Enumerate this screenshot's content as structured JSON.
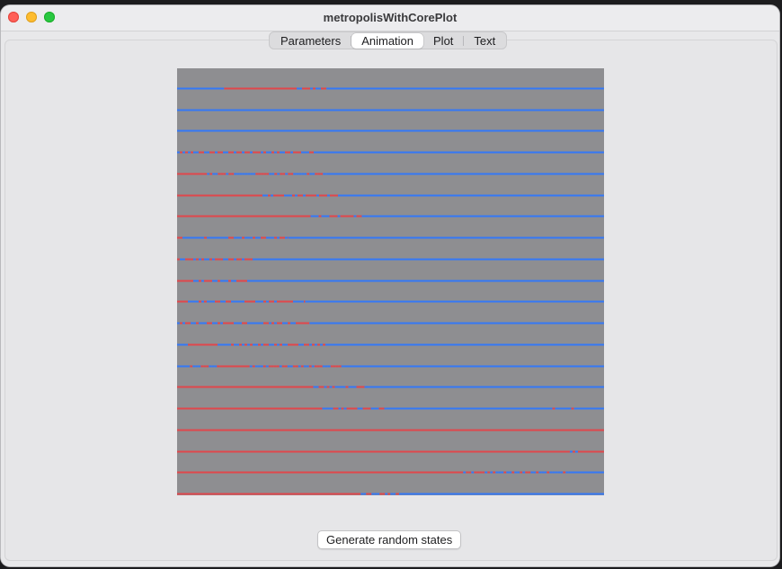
{
  "window": {
    "title": "metropolisWithCorePlot"
  },
  "tabs": [
    {
      "label": "Parameters",
      "selected": false
    },
    {
      "label": "Animation",
      "selected": true
    },
    {
      "label": "Plot",
      "selected": false
    },
    {
      "label": "Text",
      "selected": false
    }
  ],
  "animation": {
    "background_color": "#8e8e91",
    "spin_up_color": "#e0474c",
    "spin_down_color": "#3478f6",
    "rows": [
      {
        "segments": [
          [
            0.0,
            0.11,
            "down"
          ],
          [
            0.11,
            0.28,
            "up"
          ],
          [
            0.28,
            0.35,
            "mixed"
          ],
          [
            0.35,
            1.0,
            "down"
          ]
        ]
      },
      {
        "segments": [
          [
            0.0,
            1.0,
            "down"
          ]
        ]
      },
      {
        "segments": [
          [
            0.0,
            1.0,
            "down"
          ]
        ]
      },
      {
        "segments": [
          [
            0.0,
            0.32,
            "mixed"
          ],
          [
            0.32,
            1.0,
            "down"
          ]
        ]
      },
      {
        "segments": [
          [
            0.0,
            0.07,
            "up"
          ],
          [
            0.07,
            0.35,
            "mixed"
          ],
          [
            0.35,
            1.0,
            "down"
          ]
        ]
      },
      {
        "segments": [
          [
            0.0,
            0.2,
            "up"
          ],
          [
            0.2,
            0.38,
            "mixed"
          ],
          [
            0.38,
            1.0,
            "down"
          ]
        ]
      },
      {
        "segments": [
          [
            0.0,
            0.3,
            "up"
          ],
          [
            0.3,
            0.45,
            "mixed"
          ],
          [
            0.45,
            1.0,
            "down"
          ]
        ]
      },
      {
        "segments": [
          [
            0.0,
            0.26,
            "mixed"
          ],
          [
            0.26,
            1.0,
            "down"
          ]
        ]
      },
      {
        "segments": [
          [
            0.0,
            0.2,
            "mixed"
          ],
          [
            0.2,
            1.0,
            "down"
          ]
        ]
      },
      {
        "segments": [
          [
            0.0,
            0.18,
            "mixed"
          ],
          [
            0.18,
            1.0,
            "down"
          ]
        ]
      },
      {
        "segments": [
          [
            0.0,
            0.3,
            "mixed"
          ],
          [
            0.3,
            1.0,
            "down"
          ]
        ]
      },
      {
        "segments": [
          [
            0.0,
            0.31,
            "mixed"
          ],
          [
            0.31,
            1.0,
            "down"
          ]
        ]
      },
      {
        "segments": [
          [
            0.0,
            0.36,
            "mixed"
          ],
          [
            0.36,
            1.0,
            "down"
          ]
        ]
      },
      {
        "segments": [
          [
            0.0,
            0.03,
            "down"
          ],
          [
            0.03,
            0.1,
            "mixed"
          ],
          [
            0.1,
            0.17,
            "up"
          ],
          [
            0.17,
            0.39,
            "mixed"
          ],
          [
            0.39,
            1.0,
            "down"
          ]
        ]
      },
      {
        "segments": [
          [
            0.0,
            0.3,
            "up"
          ],
          [
            0.3,
            0.45,
            "mixed"
          ],
          [
            0.45,
            1.0,
            "down"
          ]
        ]
      },
      {
        "segments": [
          [
            0.0,
            0.34,
            "up"
          ],
          [
            0.34,
            0.49,
            "mixed"
          ],
          [
            0.49,
            0.86,
            "down"
          ],
          [
            0.86,
            0.93,
            "mixed"
          ],
          [
            0.93,
            1.0,
            "down"
          ]
        ]
      },
      {
        "segments": [
          [
            0.0,
            1.0,
            "up"
          ]
        ]
      },
      {
        "segments": [
          [
            0.0,
            0.92,
            "up"
          ],
          [
            0.92,
            1.0,
            "mixed"
          ]
        ]
      },
      {
        "segments": [
          [
            0.0,
            0.67,
            "up"
          ],
          [
            0.67,
            0.92,
            "mixed"
          ],
          [
            0.92,
            1.0,
            "down"
          ]
        ]
      },
      {
        "segments": [
          [
            0.0,
            0.43,
            "up"
          ],
          [
            0.43,
            0.52,
            "mixed"
          ],
          [
            0.52,
            1.0,
            "down"
          ]
        ]
      }
    ]
  },
  "actions": {
    "generate_label": "Generate random states"
  }
}
